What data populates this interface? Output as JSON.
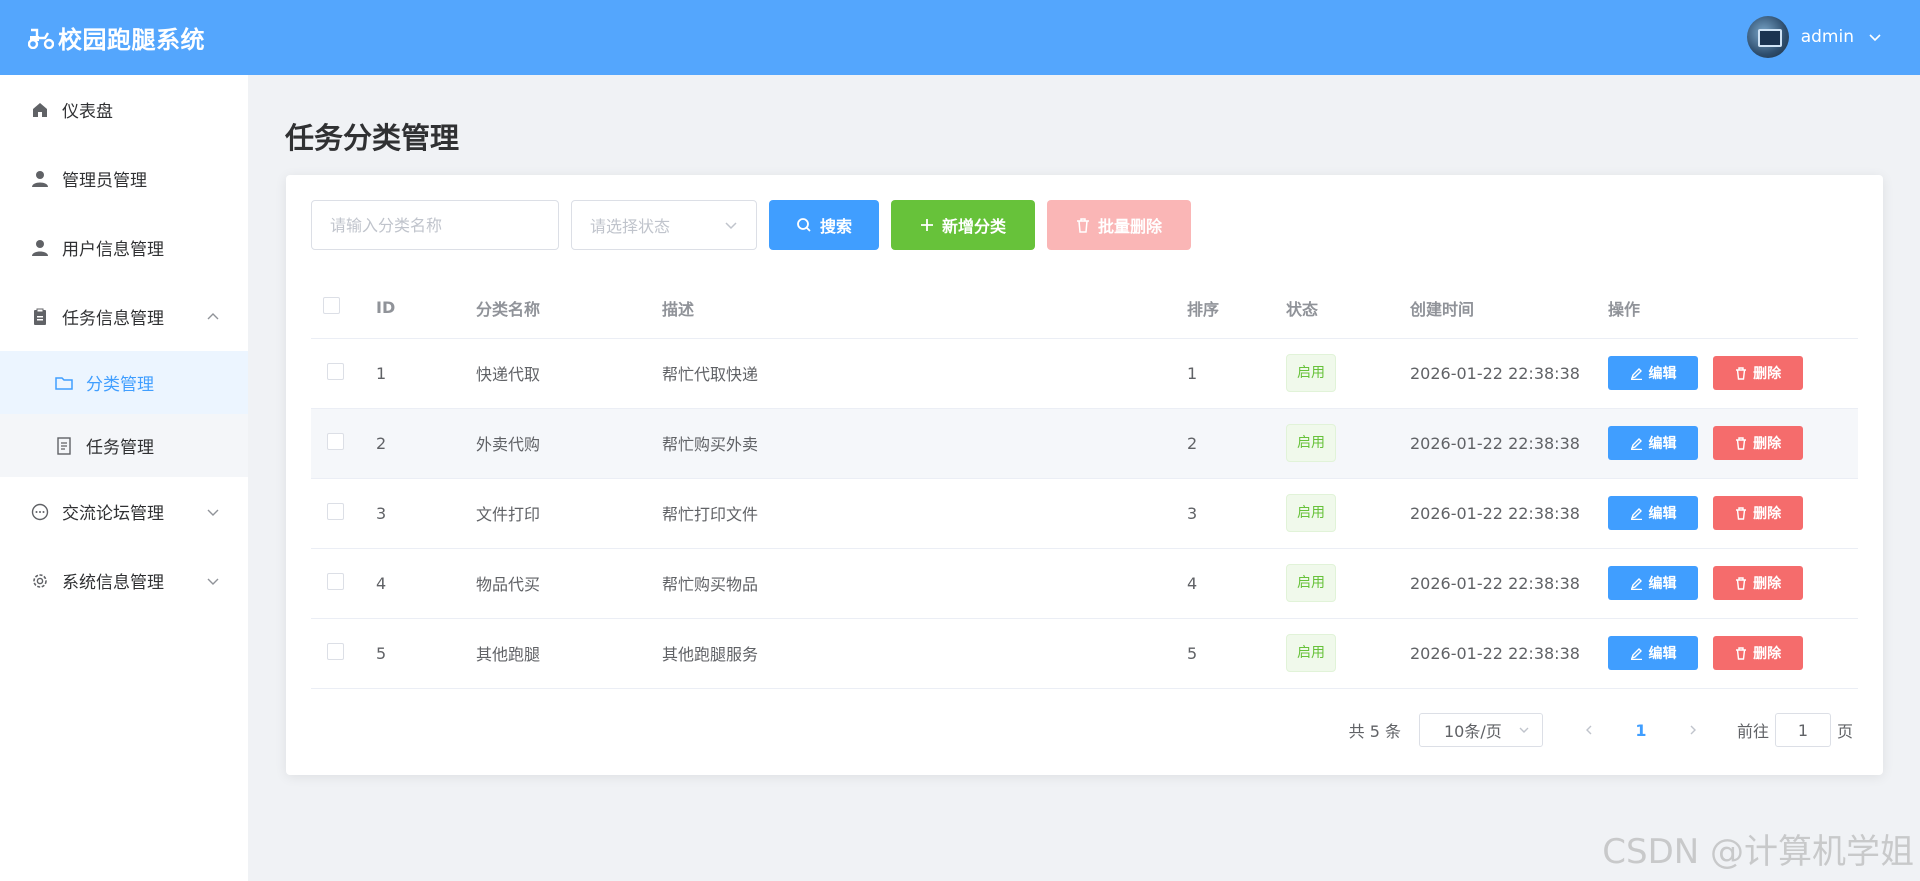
{
  "header": {
    "title": "校园跑腿系统",
    "username": "admin"
  },
  "sidebar": {
    "items": [
      {
        "label": "仪表盘",
        "icon": "home-icon"
      },
      {
        "label": "管理员管理",
        "icon": "user-icon"
      },
      {
        "label": "用户信息管理",
        "icon": "user-icon"
      },
      {
        "label": "任务信息管理",
        "icon": "clipboard-icon",
        "expanded": true,
        "children": [
          {
            "label": "分类管理",
            "icon": "folder-icon",
            "active": true
          },
          {
            "label": "任务管理",
            "icon": "document-icon"
          }
        ]
      },
      {
        "label": "交流论坛管理",
        "icon": "chat-icon"
      },
      {
        "label": "系统信息管理",
        "icon": "gear-icon"
      }
    ]
  },
  "page": {
    "title": "任务分类管理"
  },
  "toolbar": {
    "name_placeholder": "请输入分类名称",
    "status_placeholder": "请选择状态",
    "search_label": "搜索",
    "add_label": "新增分类",
    "batch_delete_label": "批量删除"
  },
  "table": {
    "headers": [
      "ID",
      "分类名称",
      "描述",
      "排序",
      "状态",
      "创建时间",
      "操作"
    ],
    "rows": [
      {
        "id": "1",
        "name": "快递代取",
        "desc": "帮忙代取快递",
        "sort": "1",
        "status": "启用",
        "created": "2026-01-22 22:38:38"
      },
      {
        "id": "2",
        "name": "外卖代购",
        "desc": "帮忙购买外卖",
        "sort": "2",
        "status": "启用",
        "created": "2026-01-22 22:38:38"
      },
      {
        "id": "3",
        "name": "文件打印",
        "desc": "帮忙打印文件",
        "sort": "3",
        "status": "启用",
        "created": "2026-01-22 22:38:38"
      },
      {
        "id": "4",
        "name": "物品代买",
        "desc": "帮忙购买物品",
        "sort": "4",
        "status": "启用",
        "created": "2026-01-22 22:38:38"
      },
      {
        "id": "5",
        "name": "其他跑腿",
        "desc": "其他跑腿服务",
        "sort": "5",
        "status": "启用",
        "created": "2026-01-22 22:38:38"
      }
    ],
    "edit_label": "编辑",
    "delete_label": "删除"
  },
  "pagination": {
    "total": "共 5 条",
    "page_size": "10条/页",
    "current": "1",
    "goto_prefix": "前往",
    "goto_value": "1",
    "goto_suffix": "页"
  },
  "watermark": "CSDN @计算机学姐",
  "colors": {
    "header": "#54a6fd",
    "primary": "#409eff",
    "success": "#67c23a",
    "danger": "#f56c6c"
  }
}
